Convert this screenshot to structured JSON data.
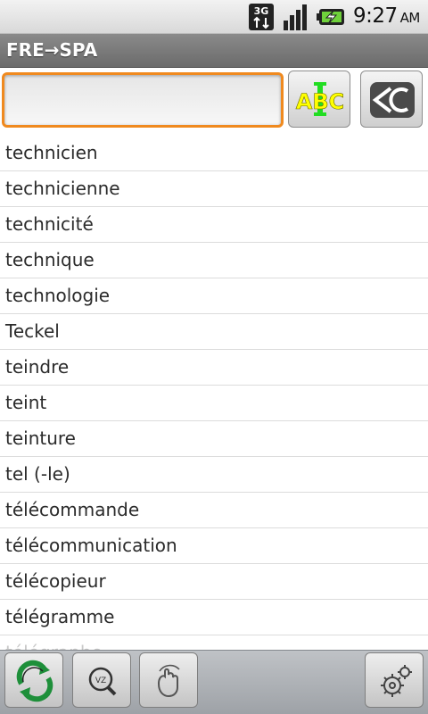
{
  "status_bar": {
    "network_label": "3G",
    "time": "9:27",
    "ampm": "AM",
    "icons": [
      "3g-data-icon",
      "signal-strength-icon",
      "battery-charging-icon"
    ]
  },
  "header": {
    "title": "FRE→SPA"
  },
  "search": {
    "value": "",
    "placeholder": ""
  },
  "buttons": {
    "spellcheck_icon": "abc-spellcheck-icon",
    "spellcheck_text": "ABC",
    "clear_icon": "clear-c-icon"
  },
  "words": [
    "technicien",
    "technicienne",
    "technicité",
    "technique",
    "technologie",
    "Teckel",
    "teindre",
    "teint",
    "teinture",
    "tel (-le)",
    "télécommande",
    "télécommunication",
    "télécopieur",
    "télégramme",
    "télégraphe"
  ],
  "toolbar": {
    "icons": [
      "sync-arrows-icon",
      "zoom-search-icon",
      "gesture-hand-icon",
      "settings-gears-icon"
    ]
  },
  "colors": {
    "search_border": "#f08a1f",
    "title_bar": "#7a7a7a",
    "abc_text": "#ffff00",
    "abc_bar": "#22dd22"
  }
}
